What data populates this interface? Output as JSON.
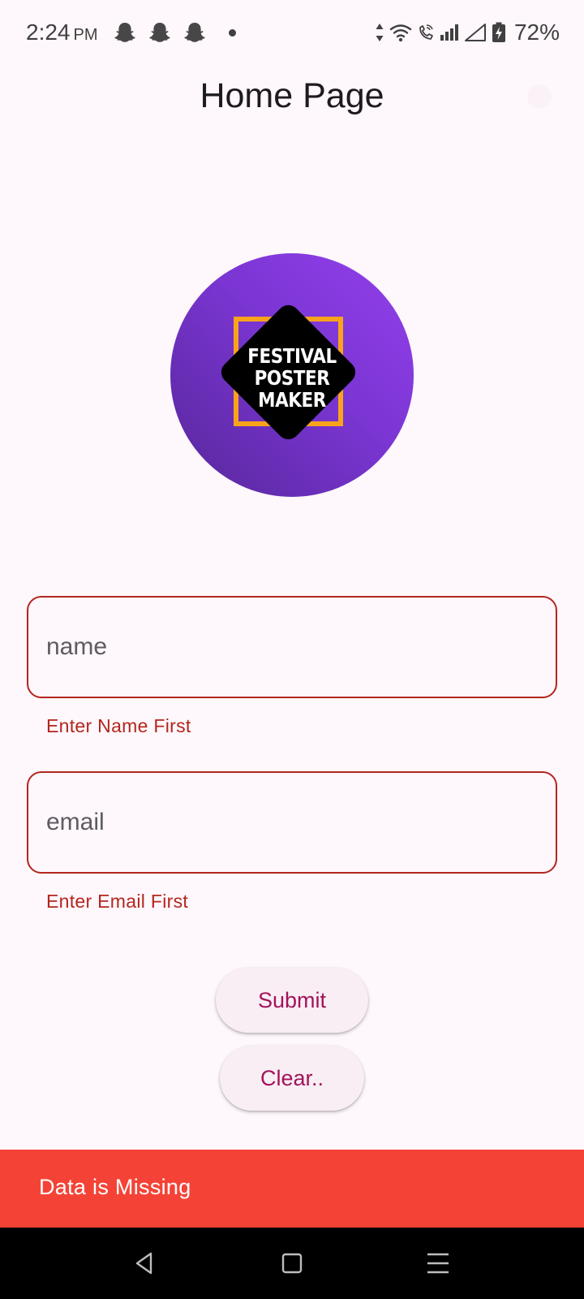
{
  "status_bar": {
    "time": "2:24",
    "ampm": "PM",
    "battery": "72%",
    "icons": [
      "snapchat-icon",
      "snapchat-icon",
      "snapchat-icon",
      "data-arrows-icon",
      "wifi-icon",
      "wifi-call-icon",
      "signal-icon",
      "signal-empty-icon",
      "battery-charging-icon"
    ]
  },
  "app_bar": {
    "title": "Home Page"
  },
  "logo": {
    "line1": "FESTIVAL",
    "line2": "POSTER",
    "line3": "MAKER",
    "colors": {
      "circle_start": "#56279a",
      "circle_end": "#9340ec",
      "frame": "#f8a31b",
      "diamond": "#000000"
    }
  },
  "form": {
    "name": {
      "placeholder": "name",
      "value": "",
      "error": "Enter Name First"
    },
    "email": {
      "placeholder": "email",
      "value": "",
      "error": "Enter Email First"
    }
  },
  "buttons": {
    "submit": "Submit",
    "clear": "Clear.."
  },
  "snackbar": {
    "message": "Data is Missing",
    "color": "#f44336"
  },
  "colors": {
    "background": "#fef7fb",
    "error": "#b3261e",
    "button_text": "#a3135a",
    "button_bg": "#f8eef4"
  }
}
